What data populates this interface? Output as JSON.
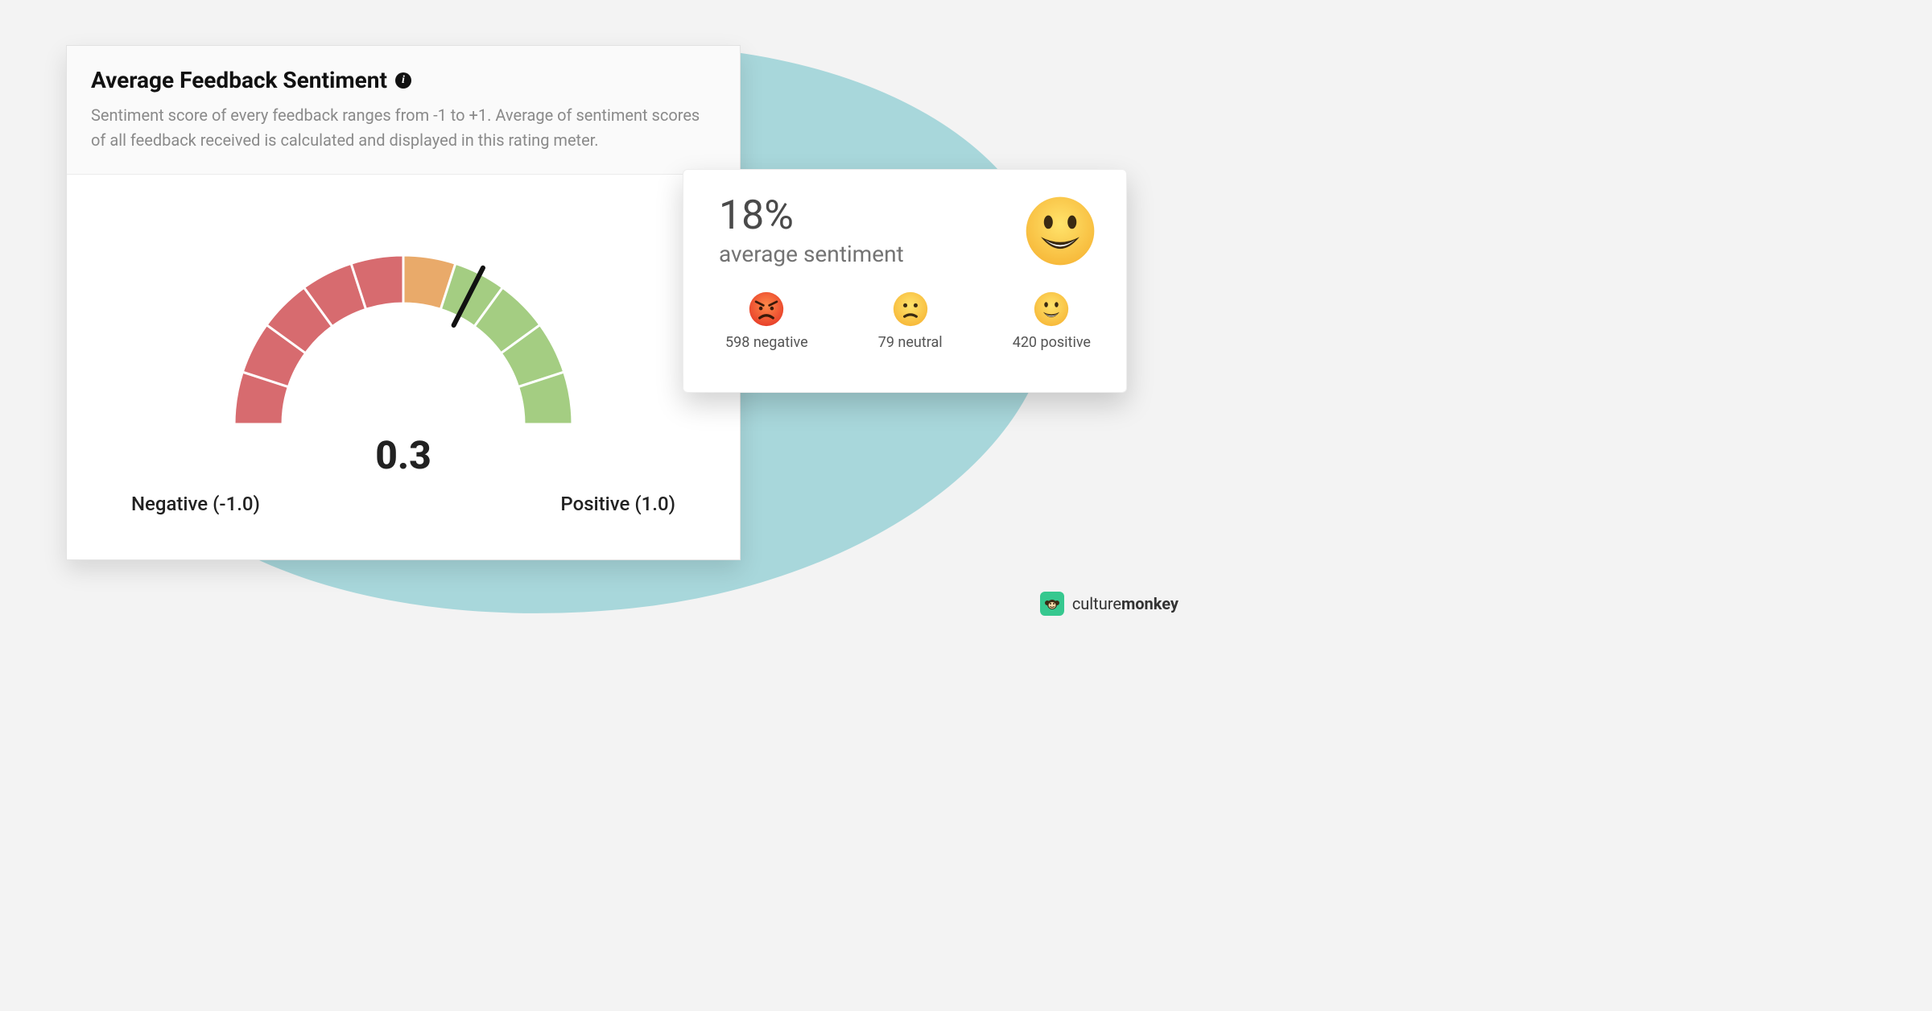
{
  "card": {
    "title": "Average Feedback Sentiment",
    "description": "Sentiment score of every feedback ranges from -1 to +1. Average of sentiment scores of all feedback received is calculated and displayed in this rating meter.",
    "gauge_value": "0.3",
    "label_negative": "Negative (-1.0)",
    "label_positive": "Positive (1.0)"
  },
  "side": {
    "percent": "18%",
    "subtitle": "average sentiment",
    "negative": "598 negative",
    "neutral": "79 neutral",
    "positive": "420 positive"
  },
  "brand": {
    "prefix": "culture",
    "bold": "monkey"
  },
  "chart_data": {
    "type": "gauge",
    "title": "Average Feedback Sentiment",
    "range": [
      -1.0,
      1.0
    ],
    "value": 0.3,
    "labels": {
      "min": "Negative (-1.0)",
      "max": "Positive (1.0)"
    },
    "segments": [
      {
        "from": -1.0,
        "to": -0.8,
        "color": "#d76b6f"
      },
      {
        "from": -0.8,
        "to": -0.6,
        "color": "#d76b6f"
      },
      {
        "from": -0.6,
        "to": -0.4,
        "color": "#d76b6f"
      },
      {
        "from": -0.4,
        "to": -0.2,
        "color": "#d76b6f"
      },
      {
        "from": -0.2,
        "to": 0.0,
        "color": "#d76b6f"
      },
      {
        "from": 0.0,
        "to": 0.2,
        "color": "#e9aa6a"
      },
      {
        "from": 0.2,
        "to": 0.4,
        "color": "#a4cd82"
      },
      {
        "from": 0.4,
        "to": 0.6,
        "color": "#a4cd82"
      },
      {
        "from": 0.6,
        "to": 0.8,
        "color": "#a4cd82"
      },
      {
        "from": 0.8,
        "to": 1.0,
        "color": "#a4cd82"
      }
    ],
    "summary": {
      "average_sentiment_percent": 18,
      "counts": {
        "negative": 598,
        "neutral": 79,
        "positive": 420
      }
    }
  }
}
